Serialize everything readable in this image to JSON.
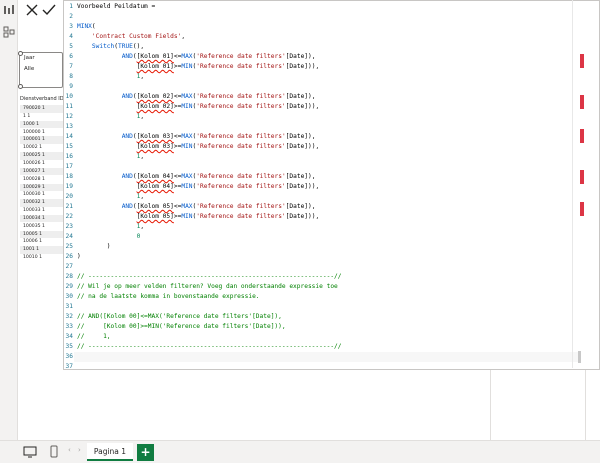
{
  "formula_bar": {
    "cancel_icon": "x-icon",
    "commit_icon": "check-icon"
  },
  "slicer": {
    "title": "Jaar",
    "value": "Alle"
  },
  "table": {
    "header": "Dienstverband ID",
    "rows": [
      "790020 1",
      "1 1",
      "1000 1",
      "100000 1",
      "100001 1",
      "10002 1",
      "100025 1",
      "100026 1",
      "100027 1",
      "100028 1",
      "100029 1",
      "100030 1",
      "100032 1",
      "100033 1",
      "100034 1",
      "100035 1",
      "10005 1",
      "10006 1",
      "1001 1",
      "10010 1"
    ]
  },
  "editor": {
    "lines": [
      "Voorbeeld Peildatum =",
      "",
      "MINX(",
      "    'Contract Custom Fields',",
      "    Switch(TRUE(),",
      "            AND([Kolom 01]<=MAX('Reference date filters'[Date]),",
      "                [Kolom 01]>=MIN('Reference date filters'[Date])),",
      "                1,",
      "",
      "            AND([Kolom 02]<=MAX('Reference date filters'[Date]),",
      "                [Kolom 02]>=MIN('Reference date filters'[Date])),",
      "                1,",
      "",
      "            AND([Kolom 03]<=MAX('Reference date filters'[Date]),",
      "                [Kolom 03]>=MIN('Reference date filters'[Date])),",
      "                1,",
      "",
      "            AND([Kolom 04]<=MAX('Reference date filters'[Date]),",
      "                [Kolom 04]>=MIN('Reference date filters'[Date])),",
      "                1,",
      "            AND([Kolom 05]<=MAX('Reference date filters'[Date]),",
      "                [Kolom 05]>=MIN('Reference date filters'[Date])),",
      "                1,",
      "                0",
      "        )",
      ")",
      "",
      "// ------------------------------------------------------------------//",
      "// Wil je op meer velden filteren? Voeg dan onderstaande expressie toe",
      "// na de laatste komma in bovenstaande expressie.",
      "",
      "// AND([Kolom 00]<=MAX('Reference date filters'[Date]),",
      "//     [Kolom 00]>=MIN('Reference date filters'[Date])),",
      "//     1,",
      "// ------------------------------------------------------------------//",
      "",
      ""
    ],
    "line_numbers": [
      "1",
      "2",
      "3",
      "4",
      "5",
      "6",
      "7",
      "8",
      "9",
      "10",
      "11",
      "12",
      "13",
      "14",
      "15",
      "16",
      "17",
      "18",
      "19",
      "20",
      "21",
      "22",
      "23",
      "24",
      "25",
      "26",
      "27",
      "28",
      "29",
      "30",
      "31",
      "32",
      "33",
      "34",
      "35",
      "36",
      "37"
    ]
  },
  "pages": {
    "tabs": [
      "Pagina 1"
    ],
    "add_label": "+"
  },
  "colors": {
    "accent": "#107c41",
    "error_marker": "#dc3545",
    "comment": "#008000",
    "string": "#a31515",
    "keyword": "#035aca",
    "number": "#09885a",
    "line_number": "#237893"
  }
}
